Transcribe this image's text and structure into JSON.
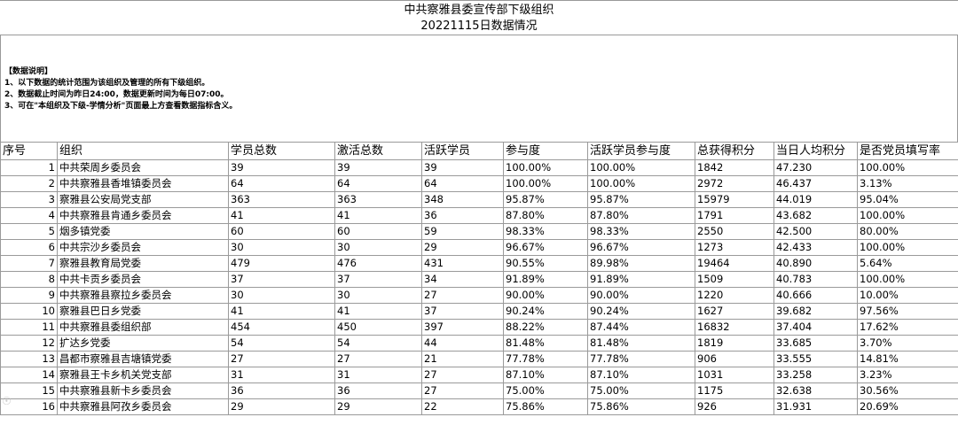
{
  "title": {
    "line1": "中共察雅县委宣传部下级组织",
    "line2": "20221115日数据情况"
  },
  "notes": {
    "heading": "【数据说明】",
    "items": [
      "1、以下数据的统计范围为该组织及管理的所有下级组织。",
      "2、数据截止时间为昨日24:00，数据更新时间为每日07:00。",
      "3、可在\"本组织及下级-学情分析\"页面最上方查看数据指标含义。"
    ]
  },
  "table": {
    "headers": [
      "序号",
      "组织",
      "学员总数",
      "激活总数",
      "活跃学员",
      "参与度",
      "活跃学员参与度",
      "总获得积分",
      "当日人均积分",
      "是否党员填写率"
    ],
    "rows": [
      [
        "1",
        "中共荣周乡委员会",
        "39",
        "39",
        "39",
        "100.00%",
        "100.00%",
        "1842",
        "47.230",
        "100.00%"
      ],
      [
        "2",
        "中共察雅县香堆镇委员会",
        "64",
        "64",
        "64",
        "100.00%",
        "100.00%",
        "2972",
        "46.437",
        "3.13%"
      ],
      [
        "3",
        "察雅县公安局党支部",
        "363",
        "363",
        "348",
        "95.87%",
        "95.87%",
        "15979",
        "44.019",
        "95.04%"
      ],
      [
        "4",
        "中共察雅县肯通乡委员会",
        "41",
        "41",
        "36",
        "87.80%",
        "87.80%",
        "1791",
        "43.682",
        "100.00%"
      ],
      [
        "5",
        "烟多镇党委",
        "60",
        "60",
        "59",
        "98.33%",
        "98.33%",
        "2550",
        "42.500",
        "80.00%"
      ],
      [
        "6",
        "中共宗沙乡委员会",
        "30",
        "30",
        "29",
        "96.67%",
        "96.67%",
        "1273",
        "42.433",
        "100.00%"
      ],
      [
        "7",
        "察雅县教育局党委",
        "479",
        "476",
        "431",
        "90.55%",
        "89.98%",
        "19464",
        "40.890",
        "5.64%"
      ],
      [
        "8",
        "中共卡贡乡委员会",
        "37",
        "37",
        "34",
        "91.89%",
        "91.89%",
        "1509",
        "40.783",
        "100.00%"
      ],
      [
        "9",
        "中共察雅县察拉乡委员会",
        "30",
        "30",
        "27",
        "90.00%",
        "90.00%",
        "1220",
        "40.666",
        "10.00%"
      ],
      [
        "10",
        "察雅县巴日乡党委",
        "41",
        "41",
        "37",
        "90.24%",
        "90.24%",
        "1627",
        "39.682",
        "97.56%"
      ],
      [
        "11",
        "中共察雅县委组织部",
        "454",
        "450",
        "397",
        "88.22%",
        "87.44%",
        "16832",
        "37.404",
        "17.62%"
      ],
      [
        "12",
        "扩达乡党委",
        "54",
        "54",
        "44",
        "81.48%",
        "81.48%",
        "1819",
        "33.685",
        "3.70%"
      ],
      [
        "13",
        "昌都市察雅县吉塘镇党委",
        "27",
        "27",
        "21",
        "77.78%",
        "77.78%",
        "906",
        "33.555",
        "14.81%"
      ],
      [
        "14",
        "察雅县王卡乡机关党支部",
        "31",
        "31",
        "27",
        "87.10%",
        "87.10%",
        "1031",
        "33.258",
        "3.23%"
      ],
      [
        "15",
        "中共察雅县新卡乡委员会",
        "36",
        "36",
        "27",
        "75.00%",
        "75.00%",
        "1175",
        "32.638",
        "30.56%"
      ],
      [
        "16",
        "中共察雅县阿孜乡委员会",
        "29",
        "29",
        "22",
        "75.86%",
        "75.86%",
        "926",
        "31.931",
        "20.69%"
      ]
    ]
  }
}
